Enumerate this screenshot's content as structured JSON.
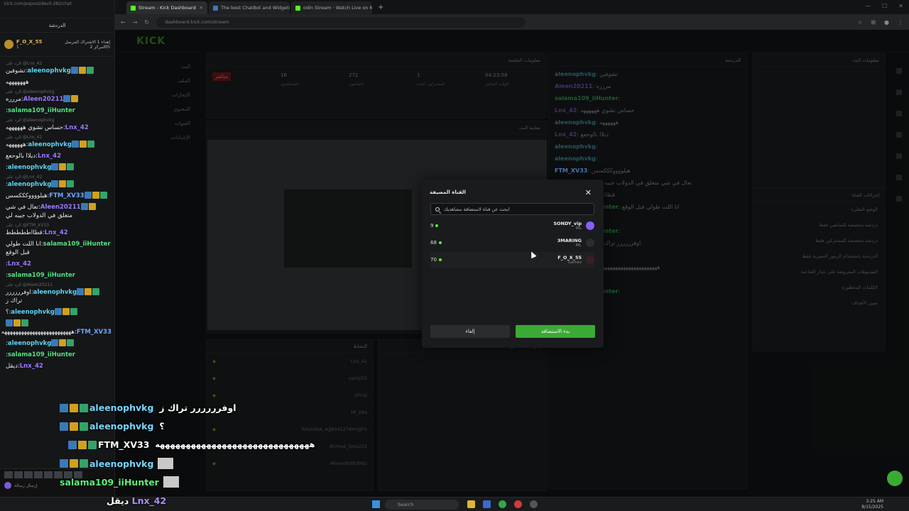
{
  "left_chat": {
    "address": "kick.com/popout/devil-282/chat",
    "title": "الدردشة",
    "pinned": {
      "name": "F_O_X_55",
      "count": "1",
      "text": "إهداء 1 الاشتراك المرسل المركز 2th"
    },
    "messages": [
      {
        "user": "aleenophvkg",
        "color": "teal",
        "badges": [
          "blue",
          "gold",
          "green"
        ],
        "text": "تشوفين",
        "cont": "هههههههه",
        "reply": "الرد على @Lnx_42"
      },
      {
        "user": "Aleen20211",
        "color": "purple",
        "badges": [
          "blue",
          "gold"
        ],
        "text": "مررره",
        "reply": "الرد على @aleenophvkg"
      },
      {
        "user": "salama109_iiHunter",
        "color": "green",
        "badges": [],
        "text": "",
        "reply": ""
      },
      {
        "user": "Lnx_42",
        "color": "purple",
        "badges": [],
        "text": "حساس تشوي ههههههه",
        "reply": "الرد على @aleenophvkg"
      },
      {
        "user": "aleenophvkg",
        "color": "teal",
        "badges": [
          "blue",
          "gold",
          "green"
        ],
        "text": "ههههههه",
        "reply": "الرد على @Lnx_42"
      },
      {
        "user": "Lnx_42",
        "color": "purple",
        "badges": [],
        "text": "ديلاا بالوحعع",
        "reply": ""
      },
      {
        "user": "aleenophvkg",
        "color": "teal",
        "badges": [
          "blue",
          "gold",
          "green"
        ],
        "text": "",
        "reply": ""
      },
      {
        "user": "aleenophvkg",
        "color": "teal",
        "badges": [
          "blue",
          "gold",
          "green"
        ],
        "text": "",
        "reply": "الرد على @Lnx_42"
      },
      {
        "user": "FTM_XV33",
        "color": "bluu",
        "badges": [
          "blue",
          "gold",
          "green"
        ],
        "text": "هيلووووكككسس",
        "reply": ""
      },
      {
        "user": "Aleen20211",
        "color": "purple",
        "badges": [
          "blue",
          "gold"
        ],
        "text": "تعال في شي متعلق في الدولاب جيبه لي",
        "reply": ""
      },
      {
        "user": "Lnx_42",
        "color": "purple",
        "badges": [],
        "text": "قطااططططط",
        "reply": "الرد على @FTM_XV33"
      },
      {
        "user": "salama109_iiHunter",
        "color": "green",
        "badges": [],
        "text": "انا اللت طولي قبل الوقع",
        "reply": ""
      },
      {
        "user": "Lnx_42",
        "color": "purple",
        "badges": [],
        "text": "",
        "reply": ""
      },
      {
        "user": "salama109_iiHunter",
        "color": "green",
        "badges": [],
        "text": "",
        "reply": ""
      },
      {
        "user": "aleenophvkg",
        "color": "teal",
        "badges": [
          "blue",
          "gold",
          "green"
        ],
        "text": "اوفرررررر تراك ز",
        "reply": "الرد على @Aleen20211"
      },
      {
        "user": "aleenophvkg",
        "color": "teal",
        "badges": [
          "blue",
          "gold",
          "green"
        ],
        "text": "؟",
        "reply": ""
      },
      {
        "user": "FTM_XV33",
        "color": "bluu",
        "badges": [
          "blue",
          "gold",
          "green"
        ],
        "text": "هههههههههههههههههههههههههه",
        "reply": ""
      },
      {
        "user": "aleenophvkg",
        "color": "teal",
        "badges": [
          "blue",
          "gold",
          "green"
        ],
        "text": "",
        "reply": ""
      },
      {
        "user": "salama109_iiHunter",
        "color": "green",
        "badges": [],
        "text": "",
        "reply": ""
      },
      {
        "user": "Lnx_42",
        "color": "purple",
        "badges": [],
        "text": "ديقل",
        "reply": ""
      }
    ],
    "input_placeholder": "إرسال رسالة"
  },
  "browser": {
    "tabs": [
      {
        "label": "Stream - Kick Dashboard",
        "active": true
      },
      {
        "label": "The best ChatBot and Widgets",
        "active": false
      },
      {
        "label": "odin Stream · Watch Live on K",
        "active": false
      }
    ],
    "url": "dashboard.kick.com/stream"
  },
  "dashboard": {
    "logo": "KICK",
    "nav": [
      "البث",
      "الملف",
      "الإنجازات",
      "المحتوى",
      "القنوات",
      "الإعدادات"
    ],
    "session_title": "معلومات الجلسة",
    "stats": [
      {
        "value": "04:23:58",
        "label": "الوقت المباشر"
      },
      {
        "value": "1",
        "label": "المشتركون الجدد"
      },
      {
        "value": "272",
        "label": "المتابعون"
      },
      {
        "value": "16",
        "label": "المشاهدون"
      }
    ],
    "live_badge": "مباشر",
    "preview_title": "معاينة البث",
    "mod_title": "إجراءات المشرف",
    "activity_title": "النشاط",
    "users": [
      "Lnx_42",
      "vaniy55",
      "zFlrss",
      "Ml_28a",
      "RASHIDA_#JJ8341278HHJJFV",
      "Ahmed_3me222",
      "Ahmed6382992"
    ],
    "chat_title": "الدردشة",
    "info_title": "معلومات البث",
    "actions_title": "إجراءات القناة",
    "actions": [
      "الوضع البطيء",
      "دردشة مخصصة للمتابعين فقط",
      "دردشة مخصصة للمشتركين فقط",
      "الدردشة باستخدام الرموز التعبيرية فقط",
      "الفيديوهات المعروضة على جدار الفتاحية",
      "الكلمات المحظورة",
      "تعيين الأهداف"
    ]
  },
  "modal": {
    "title": "القناة المضيفة",
    "search_placeholder": "ابحث عن قناة لاستضافة مشاهديك",
    "channels": [
      {
        "name": "SONDY_vip",
        "category": "IRL",
        "viewers": "9",
        "avatar_color": "#8a5cf6"
      },
      {
        "name": "3MARING",
        "category": "IRL",
        "viewers": "68",
        "avatar_color": "#2a2d30"
      },
      {
        "name": "F_O_X_55",
        "category": "Games",
        "viewers": "70",
        "avatar_color": "#3a2024"
      }
    ],
    "cancel_label": "إلغاء",
    "start_label": "بدء الاستضافة"
  },
  "big_chat": [
    {
      "user": "aleenophvkg",
      "text": "اوفرررررر تراك ز",
      "style": "teal"
    },
    {
      "user": "aleenophvkg",
      "text": "؟",
      "style": "teal"
    },
    {
      "user": "FTM_XV33",
      "text": "ههههههههههههههههههههههههههههههه",
      "style": "white"
    },
    {
      "user": "aleenophvkg",
      "text": "",
      "style": "teal"
    },
    {
      "user": "salama109_iiHunter",
      "text": "",
      "style": "green"
    }
  ],
  "bottom_chat": {
    "user": "Lnx_42",
    "text": "ديقل"
  },
  "taskbar": {
    "search": "Search",
    "time": "3:25 AM",
    "date": "8/15/2025"
  }
}
